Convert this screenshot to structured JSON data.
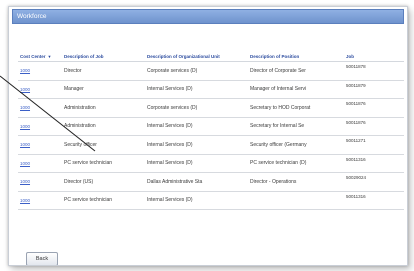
{
  "window": {
    "title": "Workforce"
  },
  "table": {
    "columns": [
      "Cost Center",
      "Description of Job",
      "Description of Organizational Unit",
      "Description of Position",
      "Job"
    ],
    "rows": [
      {
        "cost_center": "1000",
        "job": "Director",
        "org_unit": "Corporate services (D)",
        "position": "Director of Corporate Ser",
        "job_id": "50011878"
      },
      {
        "cost_center": "1000",
        "job": "Manager",
        "org_unit": "Internal Services (D)",
        "position": "Manager of Internal Servi",
        "job_id": "50011879"
      },
      {
        "cost_center": "1000",
        "job": "Administration",
        "org_unit": "Corporate services (D)",
        "position": "Secretary to HOD Corporat",
        "job_id": "50011876"
      },
      {
        "cost_center": "1000",
        "job": "Administration",
        "org_unit": "Internal Services (D)",
        "position": "Secretary for Internal Se",
        "job_id": "50011876"
      },
      {
        "cost_center": "1000",
        "job": "Security officer",
        "org_unit": "Internal Services (D)",
        "position": "Security officer (Germany",
        "job_id": "50011271"
      },
      {
        "cost_center": "1000",
        "job": "PC service technician",
        "org_unit": "Internal Services (D)",
        "position": "PC service technician (D)",
        "job_id": "50011316"
      },
      {
        "cost_center": "1000",
        "job": "Director (US)",
        "org_unit": "Dallas Administrative Sta",
        "position": "Director - Operations",
        "job_id": "50029024"
      },
      {
        "cost_center": "1000",
        "job": "PC service technician",
        "org_unit": "Internal Services (D)",
        "position": "",
        "job_id": "50011316"
      }
    ]
  },
  "back_button": {
    "label": "Back"
  },
  "colors": {
    "titlebar": "#7a9bd4",
    "header_text": "#2a4a9e",
    "link": "#3b5fc7"
  },
  "icons": {
    "sort": "sort-arrow-icon"
  }
}
